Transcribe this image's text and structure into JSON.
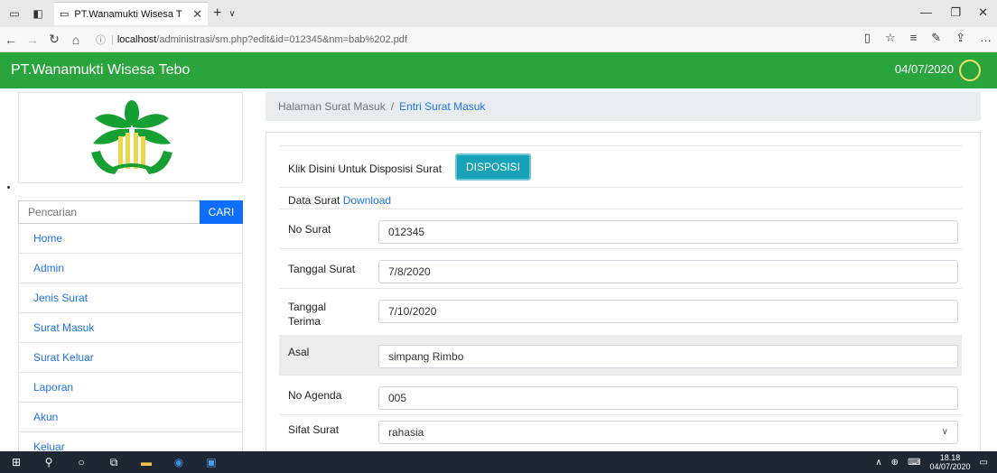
{
  "browser": {
    "tab_title": "PT.Wanamukti Wisesa T",
    "url_host": "localhost",
    "url_path": "/administrasi/sm.php?edit&id=012345&nm=bab%202.pdf"
  },
  "app": {
    "brand": "PT.Wanamukti Wisesa Tebo",
    "date": "04/07/2020"
  },
  "sidebar": {
    "search_placeholder": "Pencarian",
    "search_button": "CARI",
    "items": [
      {
        "label": "Home"
      },
      {
        "label": "Admin"
      },
      {
        "label": "Jenis Surat"
      },
      {
        "label": "Surat Masuk"
      },
      {
        "label": "Surat Keluar"
      },
      {
        "label": "Laporan"
      },
      {
        "label": "Akun"
      },
      {
        "label": "Keluar"
      }
    ]
  },
  "breadcrumb": {
    "parent": "Halaman Surat Masuk",
    "separator": "/",
    "current": "Entri Surat Masuk"
  },
  "form": {
    "disposisi_text": "Klik Disini Untuk Disposisi Surat",
    "disposisi_button": "DISPOSISI",
    "data_surat_label": "Data Surat",
    "download_link": "Download",
    "no_surat_label": "No Surat",
    "no_surat_value": "012345",
    "tanggal_surat_label": "Tanggal Surat",
    "tanggal_surat_value": "7/8/2020",
    "tanggal_terima_label": "Tanggal Terima",
    "tanggal_terima_value": "7/10/2020",
    "asal_label": "Asal",
    "asal_value": "simpang Rimbo",
    "no_agenda_label": "No Agenda",
    "no_agenda_value": "005",
    "sifat_surat_label": "Sifat Surat",
    "sifat_surat_value": "rahasia"
  },
  "taskbar": {
    "time": "18.18",
    "date": "04/07/2020"
  },
  "colors": {
    "header_green": "#2aa43c",
    "link_blue": "#1e73e8",
    "button_teal": "#17a2b8",
    "search_blue": "#0d6efd"
  }
}
